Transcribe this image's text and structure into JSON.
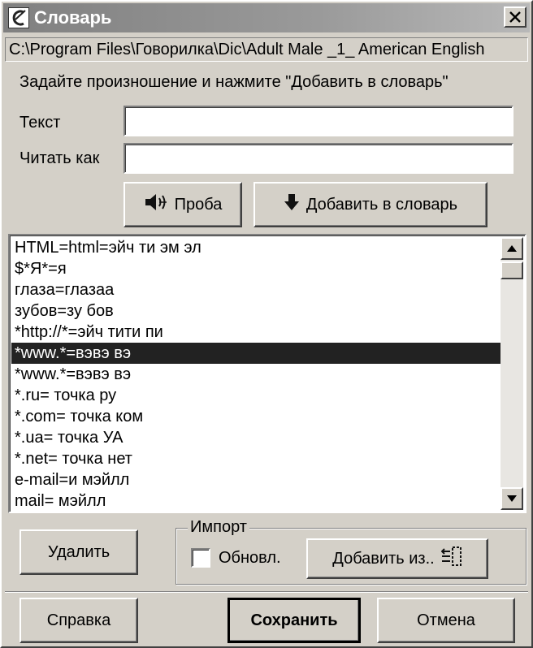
{
  "window": {
    "title": "Словарь",
    "path": "C:\\Program Files\\Говорилка\\Dic\\Adult Male _1_ American English",
    "instruction": "Задайте произношение и нажмите \"Добавить в словарь\""
  },
  "form": {
    "text_label": "Текст",
    "text_value": "",
    "read_as_label": "Читать как",
    "read_as_value": ""
  },
  "buttons": {
    "test": "Проба",
    "add_to_dict": "Добавить в словарь",
    "delete": "Удалить",
    "add_from": "Добавить из..",
    "help": "Справка",
    "save": "Сохранить",
    "cancel": "Отмена"
  },
  "import_group": {
    "legend": "Импорт",
    "update_label": "Обновл.",
    "update_checked": false
  },
  "dictionary": {
    "selected_index": 5,
    "entries": [
      "HTML=html=эйч ти эм эл",
      "$*Я*=я",
      "глаза=глазаа",
      "зубов=зу бов",
      "*http://*=эйч тити пи",
      "*www.*=вэвэ вэ",
      "*www.*=вэвэ вэ",
      "*.ru= точка ру",
      "*.com= точка ком",
      "*.ua= точка УА",
      "*.net= точка нет",
      "e-mail=и мэйлл",
      "mail= мэйлл"
    ]
  },
  "icons": {
    "app": "app-logo-icon",
    "close": "close-icon",
    "speaker": "speaker-icon",
    "down_arrow": "down-arrow-icon",
    "import": "import-list-icon",
    "scroll_up": "scroll-up-icon",
    "scroll_down": "scroll-down-icon"
  },
  "colors": {
    "title_bar": "#808080",
    "face": "#d4d0c8",
    "selection": "#222222"
  }
}
